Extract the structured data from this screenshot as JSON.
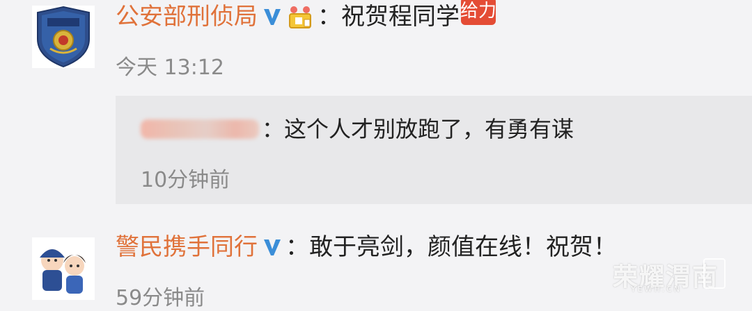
{
  "comments": [
    {
      "username": "公安部刑侦局",
      "text": "祝贺程同学",
      "tag": "给力",
      "time": "今天 13:12"
    },
    {
      "username": "警民携手同行",
      "text": "敢于亮剑，颜值在线！祝贺！",
      "time": "59分钟前"
    }
  ],
  "reply": {
    "text": "这个人才别放跑了，有勇有谋",
    "time": "10分钟前"
  },
  "watermark": {
    "brand": "荣耀渭南",
    "url": "YEWH.CN"
  },
  "colors": {
    "username": "#e0723a",
    "verified": "#3b8ed8",
    "tag_bg": "#e44c35",
    "background": "#f3f3f5",
    "reply_bg": "#e8e8ea"
  },
  "icons": {
    "verified": "verified-v-icon",
    "crown": "crown-badge-icon"
  }
}
